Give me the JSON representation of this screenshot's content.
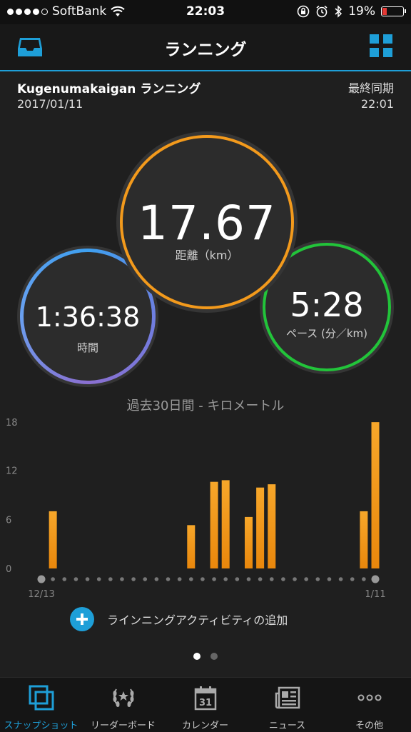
{
  "status": {
    "carrier": "SoftBank",
    "time": "22:03",
    "battery": "19%",
    "battery_level": 0.19
  },
  "nav": {
    "title": "ランニング"
  },
  "header": {
    "activity_name": "Kugenumakaigan ランニング",
    "date": "2017/01/11",
    "sync_label": "最終同期",
    "sync_time": "22:01"
  },
  "metrics": {
    "distance": {
      "value": "17.67",
      "label": "距離（km）"
    },
    "time": {
      "value": "1:36:38",
      "label": "時間"
    },
    "pace": {
      "value": "5:28",
      "label": "ペース (分／km)"
    }
  },
  "colors": {
    "accent": "#1e9fd8",
    "distance_ring": "#f39a1c",
    "pace_ring": "#22c43a",
    "bar": "#f39a1c"
  },
  "chart_title": "過去30日間 - キロメートル",
  "chart_data": {
    "type": "bar",
    "title": "過去30日間 - キロメートル",
    "yticks": [
      "18",
      "12",
      "6",
      "0"
    ],
    "ylim": [
      0,
      18
    ],
    "x_start_label": "12/13",
    "x_end_label": "1/11",
    "values": [
      0,
      7,
      0,
      0,
      0,
      0,
      0,
      0,
      0,
      0,
      0,
      0,
      0,
      5.3,
      0,
      10.6,
      10.8,
      0,
      6.3,
      9.9,
      10.3,
      0,
      0,
      0,
      0,
      0,
      0,
      0,
      7,
      17.9
    ],
    "grid": false
  },
  "add_activity": "ラインニングアクティビティの追加",
  "pager": {
    "count": 2,
    "active": 0
  },
  "tabs": [
    {
      "label": "スナップショット",
      "icon": "snapshot-icon"
    },
    {
      "label": "リーダーボード",
      "icon": "laurel-icon"
    },
    {
      "label": "カレンダー",
      "icon": "calendar-icon",
      "day": "31"
    },
    {
      "label": "ニュース",
      "icon": "news-icon"
    },
    {
      "label": "その他",
      "icon": "more-icon"
    }
  ]
}
